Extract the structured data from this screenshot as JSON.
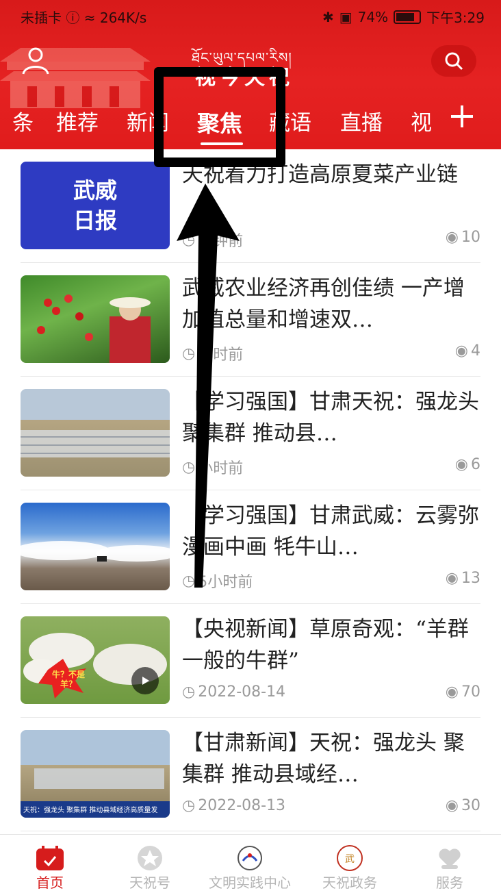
{
  "status_bar": {
    "carrier": "未插卡",
    "speed": "264K/s",
    "battery": "74%",
    "time": "下午3:29"
  },
  "header": {
    "logo_script": "ཐོང་ཡུལ་དཔལ་རིས།",
    "logo_cn": "视今天祝",
    "tabs": [
      "条",
      "推荐",
      "新闻",
      "聚焦",
      "藏语",
      "直播",
      "视"
    ],
    "active_tab": "聚焦",
    "plus_label": "+"
  },
  "news": [
    {
      "title": "天祝着力打造高原夏菜产业链",
      "time": "分钟前",
      "views": "10",
      "thumb_text": "武威\n日报",
      "thumb": "wuwei-daily"
    },
    {
      "title": "武威农业经济再创佳绩 一产增加值总量和增速双…",
      "time": "小时前",
      "views": "4",
      "thumb": "tomato"
    },
    {
      "title": "【学习强国】甘肃天祝：强龙头 聚集群 推动县…",
      "time": "小时前",
      "views": "6",
      "thumb": "greenhouse"
    },
    {
      "title": "【学习强国】甘肃武威：云雾弥漫画中画 牦牛山…",
      "time": "5小时前",
      "views": "13",
      "thumb": "clouds"
    },
    {
      "title": "【央视新闻】草原奇观：“羊群一般的牛群”",
      "time": "2022-08-14",
      "views": "70",
      "thumb": "yak",
      "thumb_badge": "牛？不是羊？"
    },
    {
      "title": "【甘肃新闻】天祝：强龙头 聚集群 推动县域经…",
      "time": "2022-08-13",
      "views": "30",
      "thumb": "news-tv",
      "thumb_caption": "天祝：强龙头 聚集群 推动县域经济高质量发"
    }
  ],
  "bottom_nav": [
    {
      "label": "首页",
      "icon": "calendar-home-icon",
      "active": true
    },
    {
      "label": "天祝号",
      "icon": "star-badge-icon",
      "active": false
    },
    {
      "label": "文明实践中心",
      "icon": "emblem-icon",
      "active": false
    },
    {
      "label": "天祝政务",
      "icon": "seal-icon",
      "active": false
    },
    {
      "label": "服务",
      "icon": "heart-hand-icon",
      "active": false
    }
  ],
  "colors": {
    "brand_red": "#e01c1c",
    "meta_gray": "#9a9a9a"
  }
}
